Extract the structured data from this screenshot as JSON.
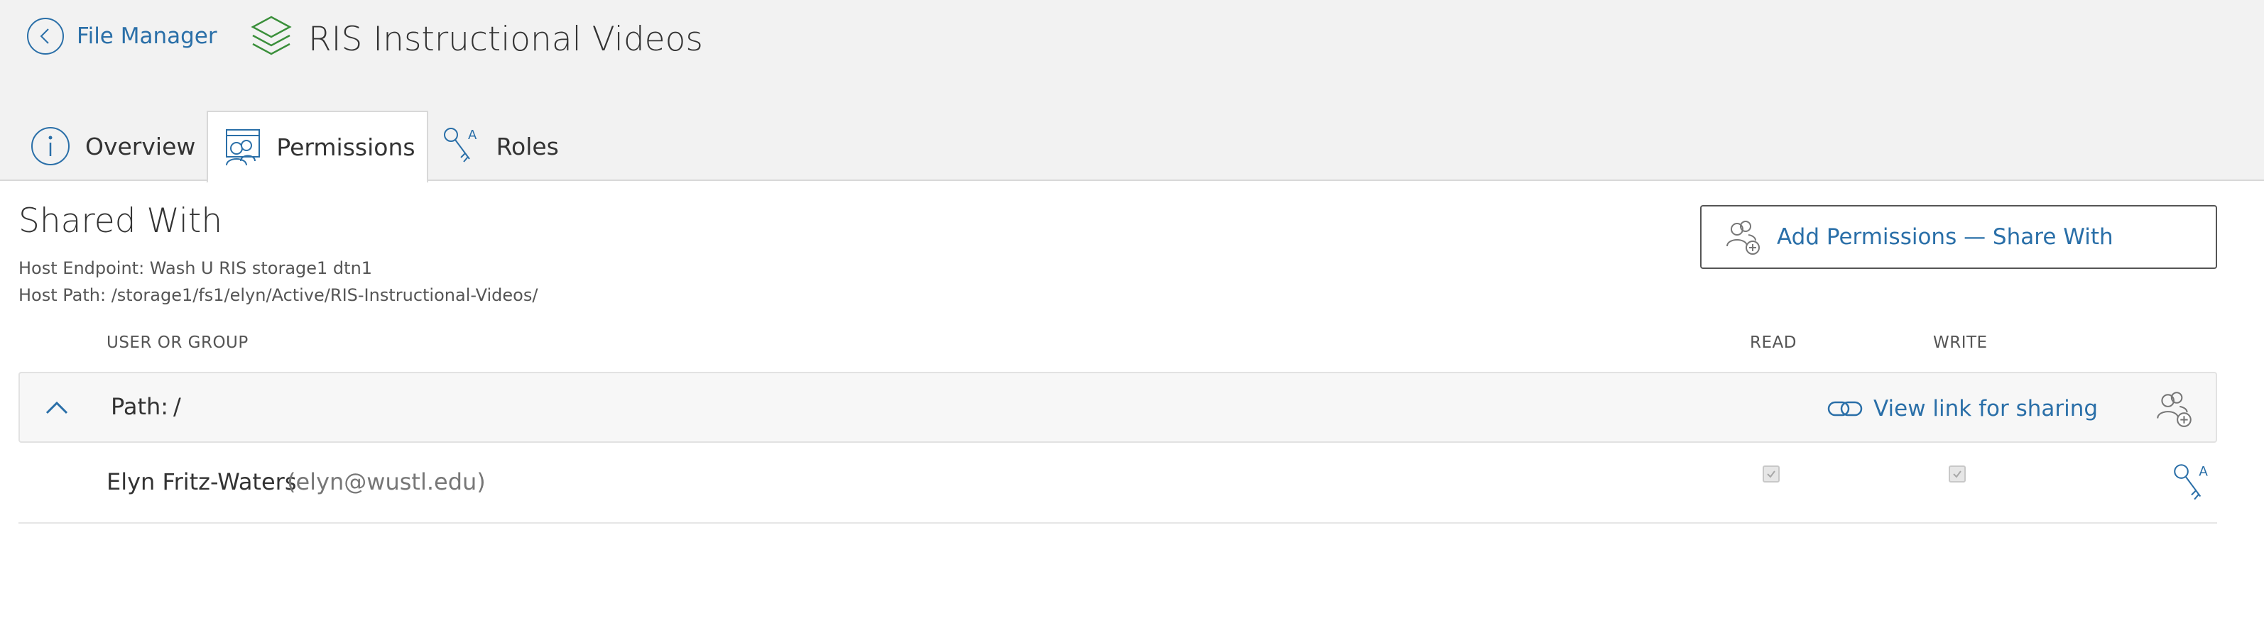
{
  "header": {
    "back_label": "File Manager",
    "title": "RIS Instructional Videos"
  },
  "tabs": [
    {
      "label": "Overview",
      "icon": "info-icon",
      "active": false
    },
    {
      "label": "Permissions",
      "icon": "permissions-icon",
      "active": true
    },
    {
      "label": "Roles",
      "icon": "roles-key-icon",
      "active": false
    }
  ],
  "shared_with": {
    "title": "Shared With",
    "host_endpoint": "Host Endpoint: Wash U RIS storage1 dtn1",
    "host_path": "Host Path: /storage1/fs1/elyn/Active/RIS-Instructional-Videos/",
    "add_button_label": "Add Permissions — Share With"
  },
  "table": {
    "columns": {
      "user": "USER OR GROUP",
      "read": "READ",
      "write": "WRITE"
    },
    "path_row": {
      "label": "Path:",
      "value": "/",
      "view_link_label": "View link for sharing"
    },
    "rows": [
      {
        "name": "Elyn Fritz-Waters",
        "email": "(elyn@wustl.edu)",
        "read": true,
        "write": true
      }
    ]
  },
  "colors": {
    "accent": "#2a6fa8",
    "icon_green": "#3a8f3a",
    "topbar_bg": "#f2f2f2"
  }
}
